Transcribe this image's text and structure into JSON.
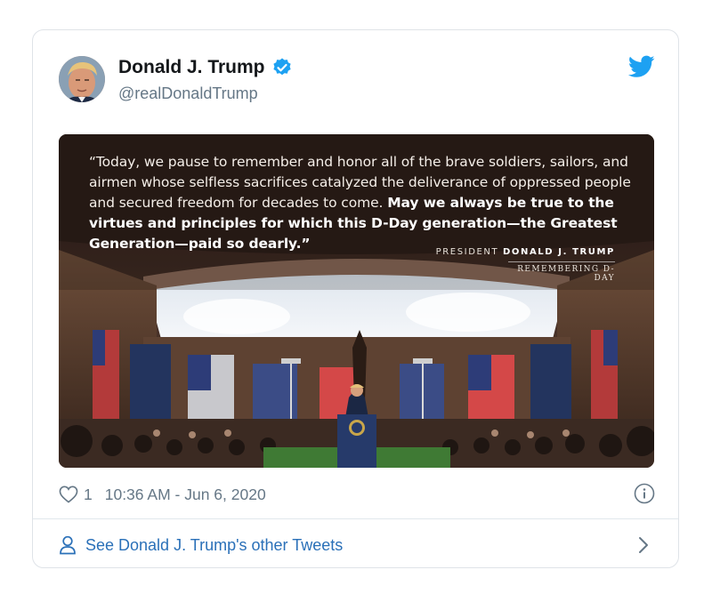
{
  "tweet": {
    "author_name": "Donald J. Trump",
    "author_handle": "@realDonaldTrump",
    "icons": {
      "avatar": "profile-photo",
      "verified": "verified-badge-icon",
      "brand": "twitter-bird-icon",
      "like": "heart-icon",
      "info": "info-icon",
      "profile": "person-icon",
      "chevron": "chevron-right-icon"
    },
    "image": {
      "quote_regular": "“Today, we pause to remember and honor all of the brave soldiers, sailors, and airmen whose selfless sacrifices catalyzed the deliverance of oppressed people and secured freedom for decades to come. ",
      "quote_bold": "May we always be true to the virtues and principles for which this D-Day generation—the Greatest Generation—paid so dearly.”",
      "signature_prefix": "PRESIDENT ",
      "signature_name": "DONALD J. TRUMP",
      "signature_subtitle": "REMEMBERING D-DAY"
    },
    "likes": "1",
    "timestamp": "10:36 AM - Jun 6, 2020",
    "footer_link": "See Donald J. Trump's other Tweets"
  },
  "colors": {
    "brand_blue": "#1da1f2",
    "link_blue": "#2a70b8",
    "muted_gray": "#657786",
    "border": "#dfe3e8"
  }
}
